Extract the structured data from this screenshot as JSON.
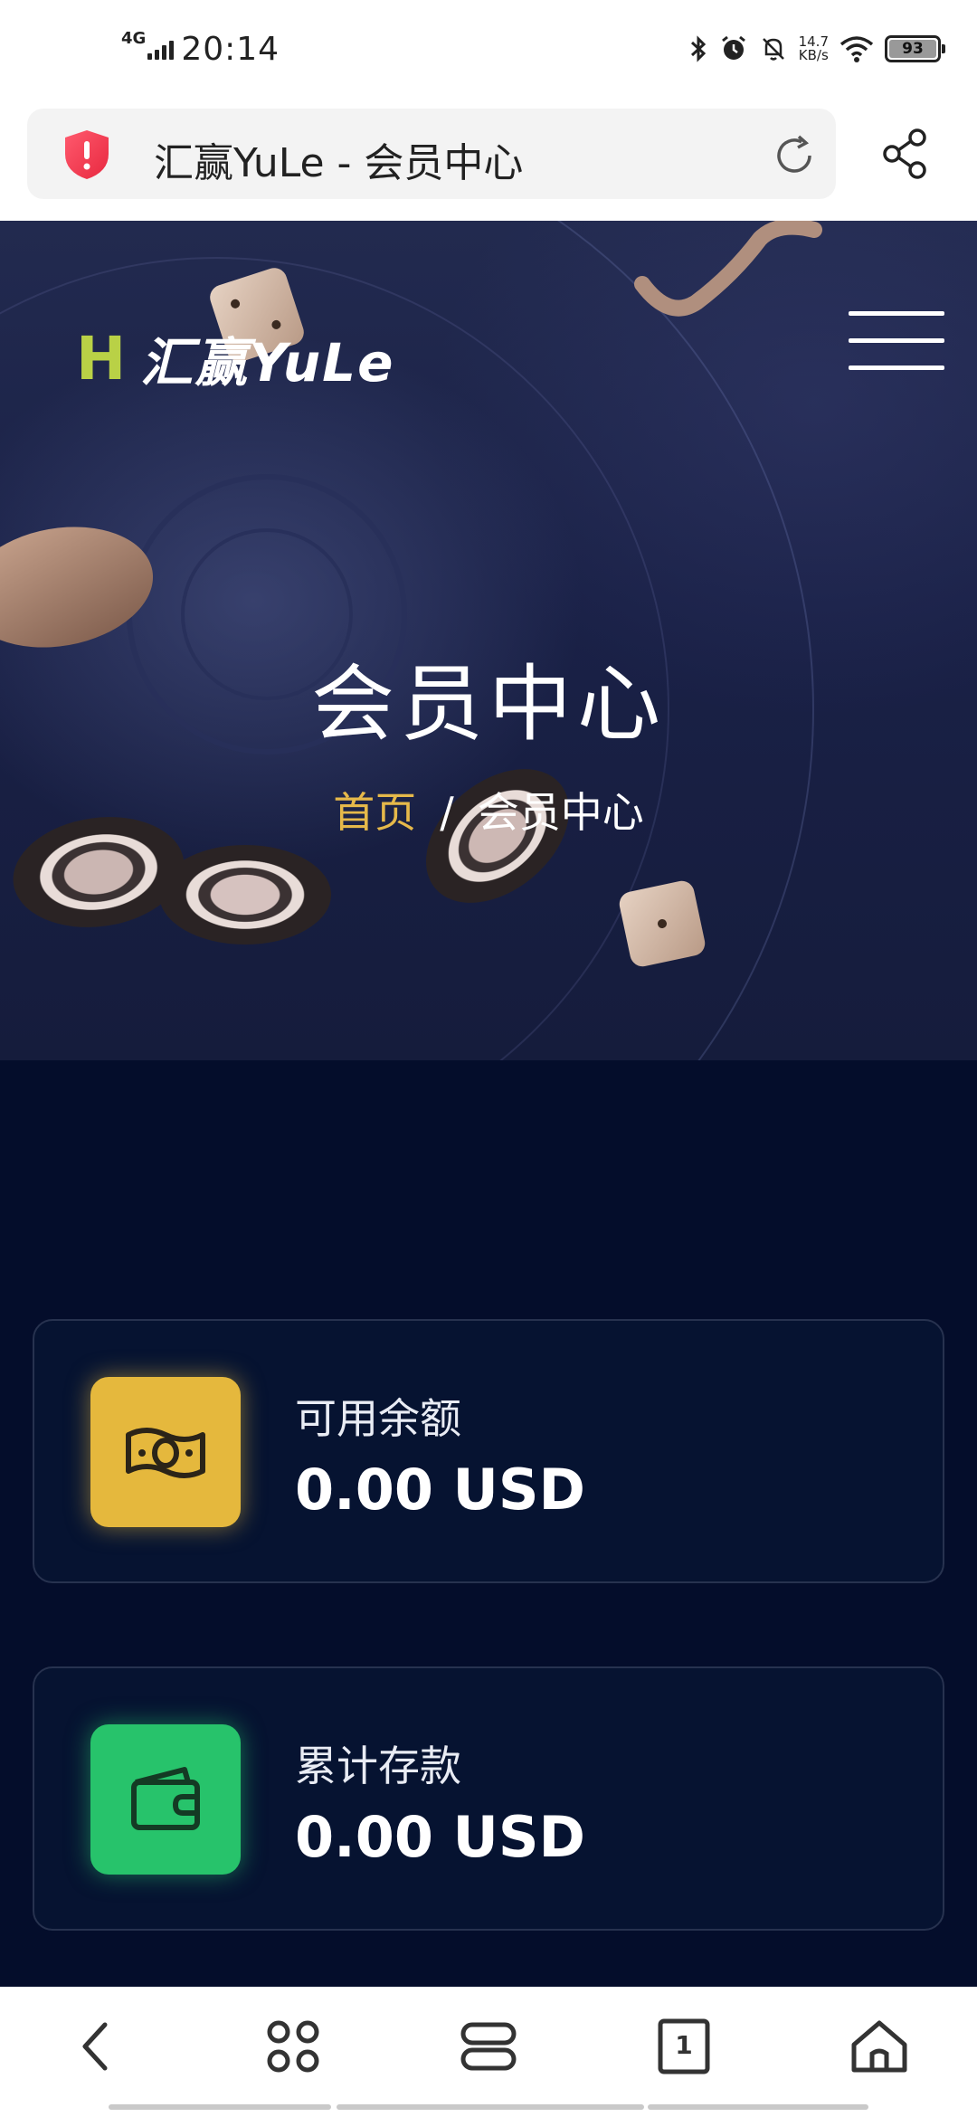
{
  "status_bar": {
    "network": "4G",
    "time": "20:14",
    "speed_value": "14.7",
    "speed_unit": "KB/s",
    "battery": "93"
  },
  "url_bar": {
    "title": "汇赢YuLe - 会员中心"
  },
  "hero": {
    "logo_letter": "H",
    "logo_text": "汇赢YuLe",
    "title": "会员中心",
    "breadcrumb_home": "首页",
    "breadcrumb_separator": "/",
    "breadcrumb_current": "会员中心"
  },
  "cards": [
    {
      "label": "可用余额",
      "value": "0.00 USD",
      "icon": "money-icon",
      "color": "#e5b83d"
    },
    {
      "label": "累计存款",
      "value": "0.00 USD",
      "icon": "wallet-icon",
      "color": "#27c36b"
    }
  ],
  "bottom_nav": {
    "tab_count": "1"
  }
}
